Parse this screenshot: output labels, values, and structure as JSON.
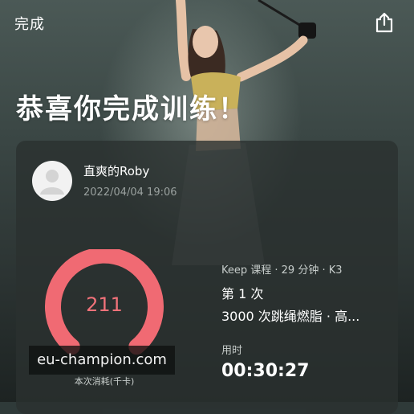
{
  "topbar": {
    "done_label": "完成",
    "share_icon": "share-icon"
  },
  "headline": "恭喜你完成训练！",
  "user": {
    "name": "直爽的Roby",
    "datetime": "2022/04/04 19:06"
  },
  "workout": {
    "calories": "211",
    "calories_label": "本次消耗(千卡)",
    "meta": "Keep 课程 · 29 分钟 · K3",
    "attempt": "第 1 次",
    "course_name": "3000 次跳绳燃脂 · 高...",
    "duration_label": "用时",
    "duration": "00:30:27"
  },
  "watermark": "eu-champion.com",
  "colors": {
    "ring": "#f06a73",
    "card": "#2a3130"
  }
}
